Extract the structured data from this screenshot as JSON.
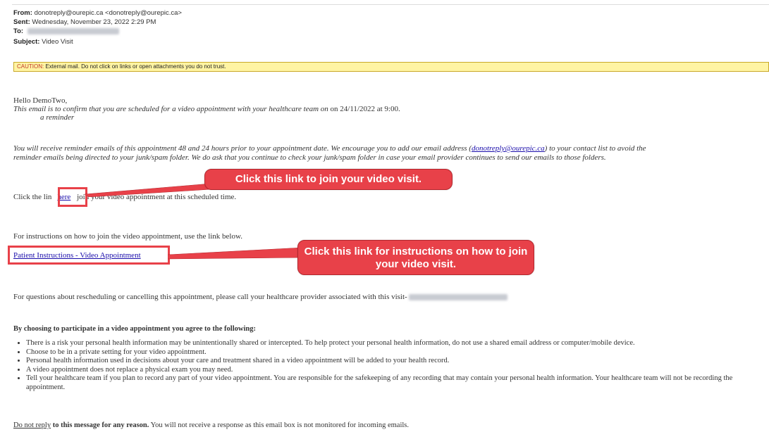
{
  "header": {
    "from_label": "From:",
    "from_value": "donotreply@ourepic.ca <donotreply@ourepic.ca>",
    "sent_label": "Sent:",
    "sent_value": "Wednesday, November 23, 2022 2:29 PM",
    "to_label": "To:",
    "subject_label": "Subject:",
    "subject_value": "Video Visit"
  },
  "caution": {
    "label": "CAUTION:",
    "text": " External mail. Do not click on links or open attachments you do not trust."
  },
  "body": {
    "greeting": "Hello DemoTwo,",
    "confirm_italic": "This email is to confirm that you are scheduled for a video appointment with your healthcare team on",
    "confirm_date": " on 24/11/2022 at 9:00.",
    "reminder_word": "a reminder",
    "reminder_para_1": "You will receive reminder emails of this appointment 48 and 24 hours prior to your appointment date.  We encourage you to add our email address (",
    "reminder_email": "donotreply@ourepic.ca",
    "reminder_para_1b": ") to your contact list to avoid the",
    "reminder_para_2": "reminder emails being directed to your junk/spam folder.  We do ask that you continue to check your junk/spam folder in case your email provider continues to send our emails to those folders.",
    "click_pre": "Click the lin",
    "here_link": "here",
    "click_post": "  join your video appointment at this scheduled time.",
    "instructions_intro": "For instructions on how to join the video appointment, use the link below.",
    "instructions_link": "Patient Instructions - Video Appointment",
    "questions": "For questions about rescheduling or cancelling this appointment, please call your healthcare provider associated with this visit-",
    "agree_heading": "By choosing to participate in a video appointment you agree to the following:",
    "bullets": [
      "There is a risk your personal health information may be unintentionally shared or intercepted. To help protect your personal health information, do not use a shared email address or computer/mobile device.",
      "Choose to be in a private setting for your video appointment.",
      "Personal health information used in decisions about your care and treatment shared in a video appointment will be added to your health record.",
      "A video appointment does not replace a physical exam you may need.",
      "Tell your healthcare team if you plan to record any part of your video appointment. You are responsible for the safekeeping of any recording that may contain your personal health information. Your healthcare team will not be recording the appointment."
    ],
    "do_not_reply_u": "Do not reply",
    "do_not_reply_b": " to this message for any reason.",
    "do_not_reply_rest": " You will not receive a response as this email box is not monitored for incoming emails."
  },
  "callouts": {
    "join": "Click this link to join your video visit.",
    "instructions": "Click this link for instructions on how to join your video visit."
  },
  "colors": {
    "callout_red": "#e84149",
    "caution_bg": "#fff4a3",
    "link_blue": "#1a0dab"
  }
}
